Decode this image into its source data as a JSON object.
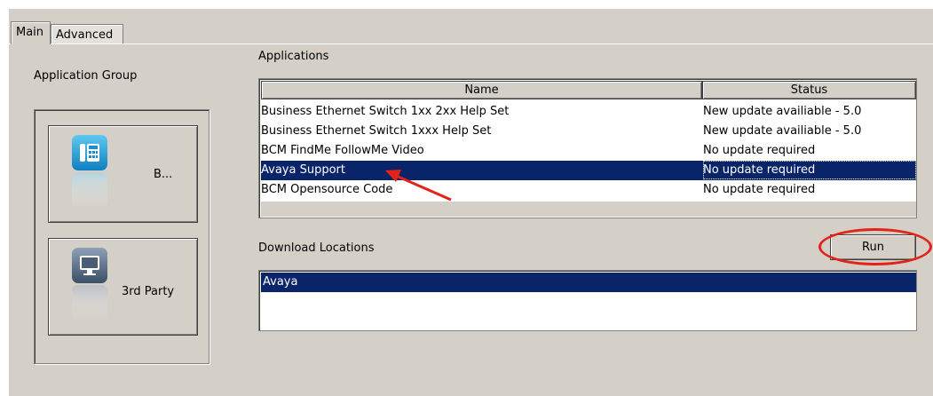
{
  "tabs": [
    {
      "label": "Main",
      "active": true
    },
    {
      "label": "Advanced",
      "active": false
    }
  ],
  "application_group": {
    "label": "Application Group",
    "buttons": [
      {
        "label": "B...",
        "icon": "phone-icon"
      },
      {
        "label": "3rd Party",
        "icon": "monitor-icon"
      }
    ]
  },
  "applications": {
    "label": "Applications",
    "columns": [
      "Name",
      "Status"
    ],
    "rows": [
      {
        "name": "Business Ethernet Switch 1xx 2xx Help Set",
        "status": "New update availiable - 5.0"
      },
      {
        "name": "Business Ethernet Switch 1xxx Help Set",
        "status": "New update availiable - 5.0"
      },
      {
        "name": "BCM FindMe FollowMe Video",
        "status": "No update required"
      },
      {
        "name": "Avaya Support",
        "status": "No update required",
        "selected": true
      },
      {
        "name": "BCM Opensource Code",
        "status": "No update required"
      }
    ]
  },
  "download_locations": {
    "label": "Download Locations",
    "items": [
      "Avaya"
    ],
    "selected": "Avaya"
  },
  "run_button": {
    "label": "Run"
  },
  "colors": {
    "background": "#d4d0c8",
    "selection": "#0a246a",
    "annotation": "#e2231a",
    "icon_blue": "#1aa0d8"
  }
}
